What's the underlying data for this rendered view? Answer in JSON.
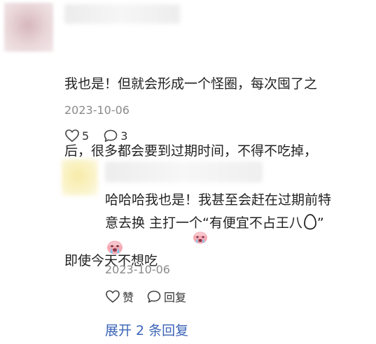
{
  "comment": {
    "text_line1": "我也是！但就会形成一个怪圈，每次囤了之",
    "text_line2": "后，很多都会要到过期时间，不得不吃掉，",
    "text_line3": "即使今天不想吃",
    "emoji": "crying-face-emoji",
    "date": "2023-10-06",
    "like_count": "5",
    "reply_count": "3"
  },
  "reply": {
    "text_line1": "哈哈哈我也是！我甚至会赶在过期前特",
    "text_line2": "意去换 主打一个“有便宜不占王八",
    "text_line2_end": "”",
    "egg_emoji": "egg-outline-emoji",
    "emoji": "crying-face-emoji",
    "date": "2023-10-06",
    "like_label": "赞",
    "reply_label": "回复"
  },
  "expand_replies": "展开 2 条回复",
  "colors": {
    "link_blue": "#3a63b6",
    "meta_gray": "#8a8a8a",
    "text": "#222222"
  }
}
